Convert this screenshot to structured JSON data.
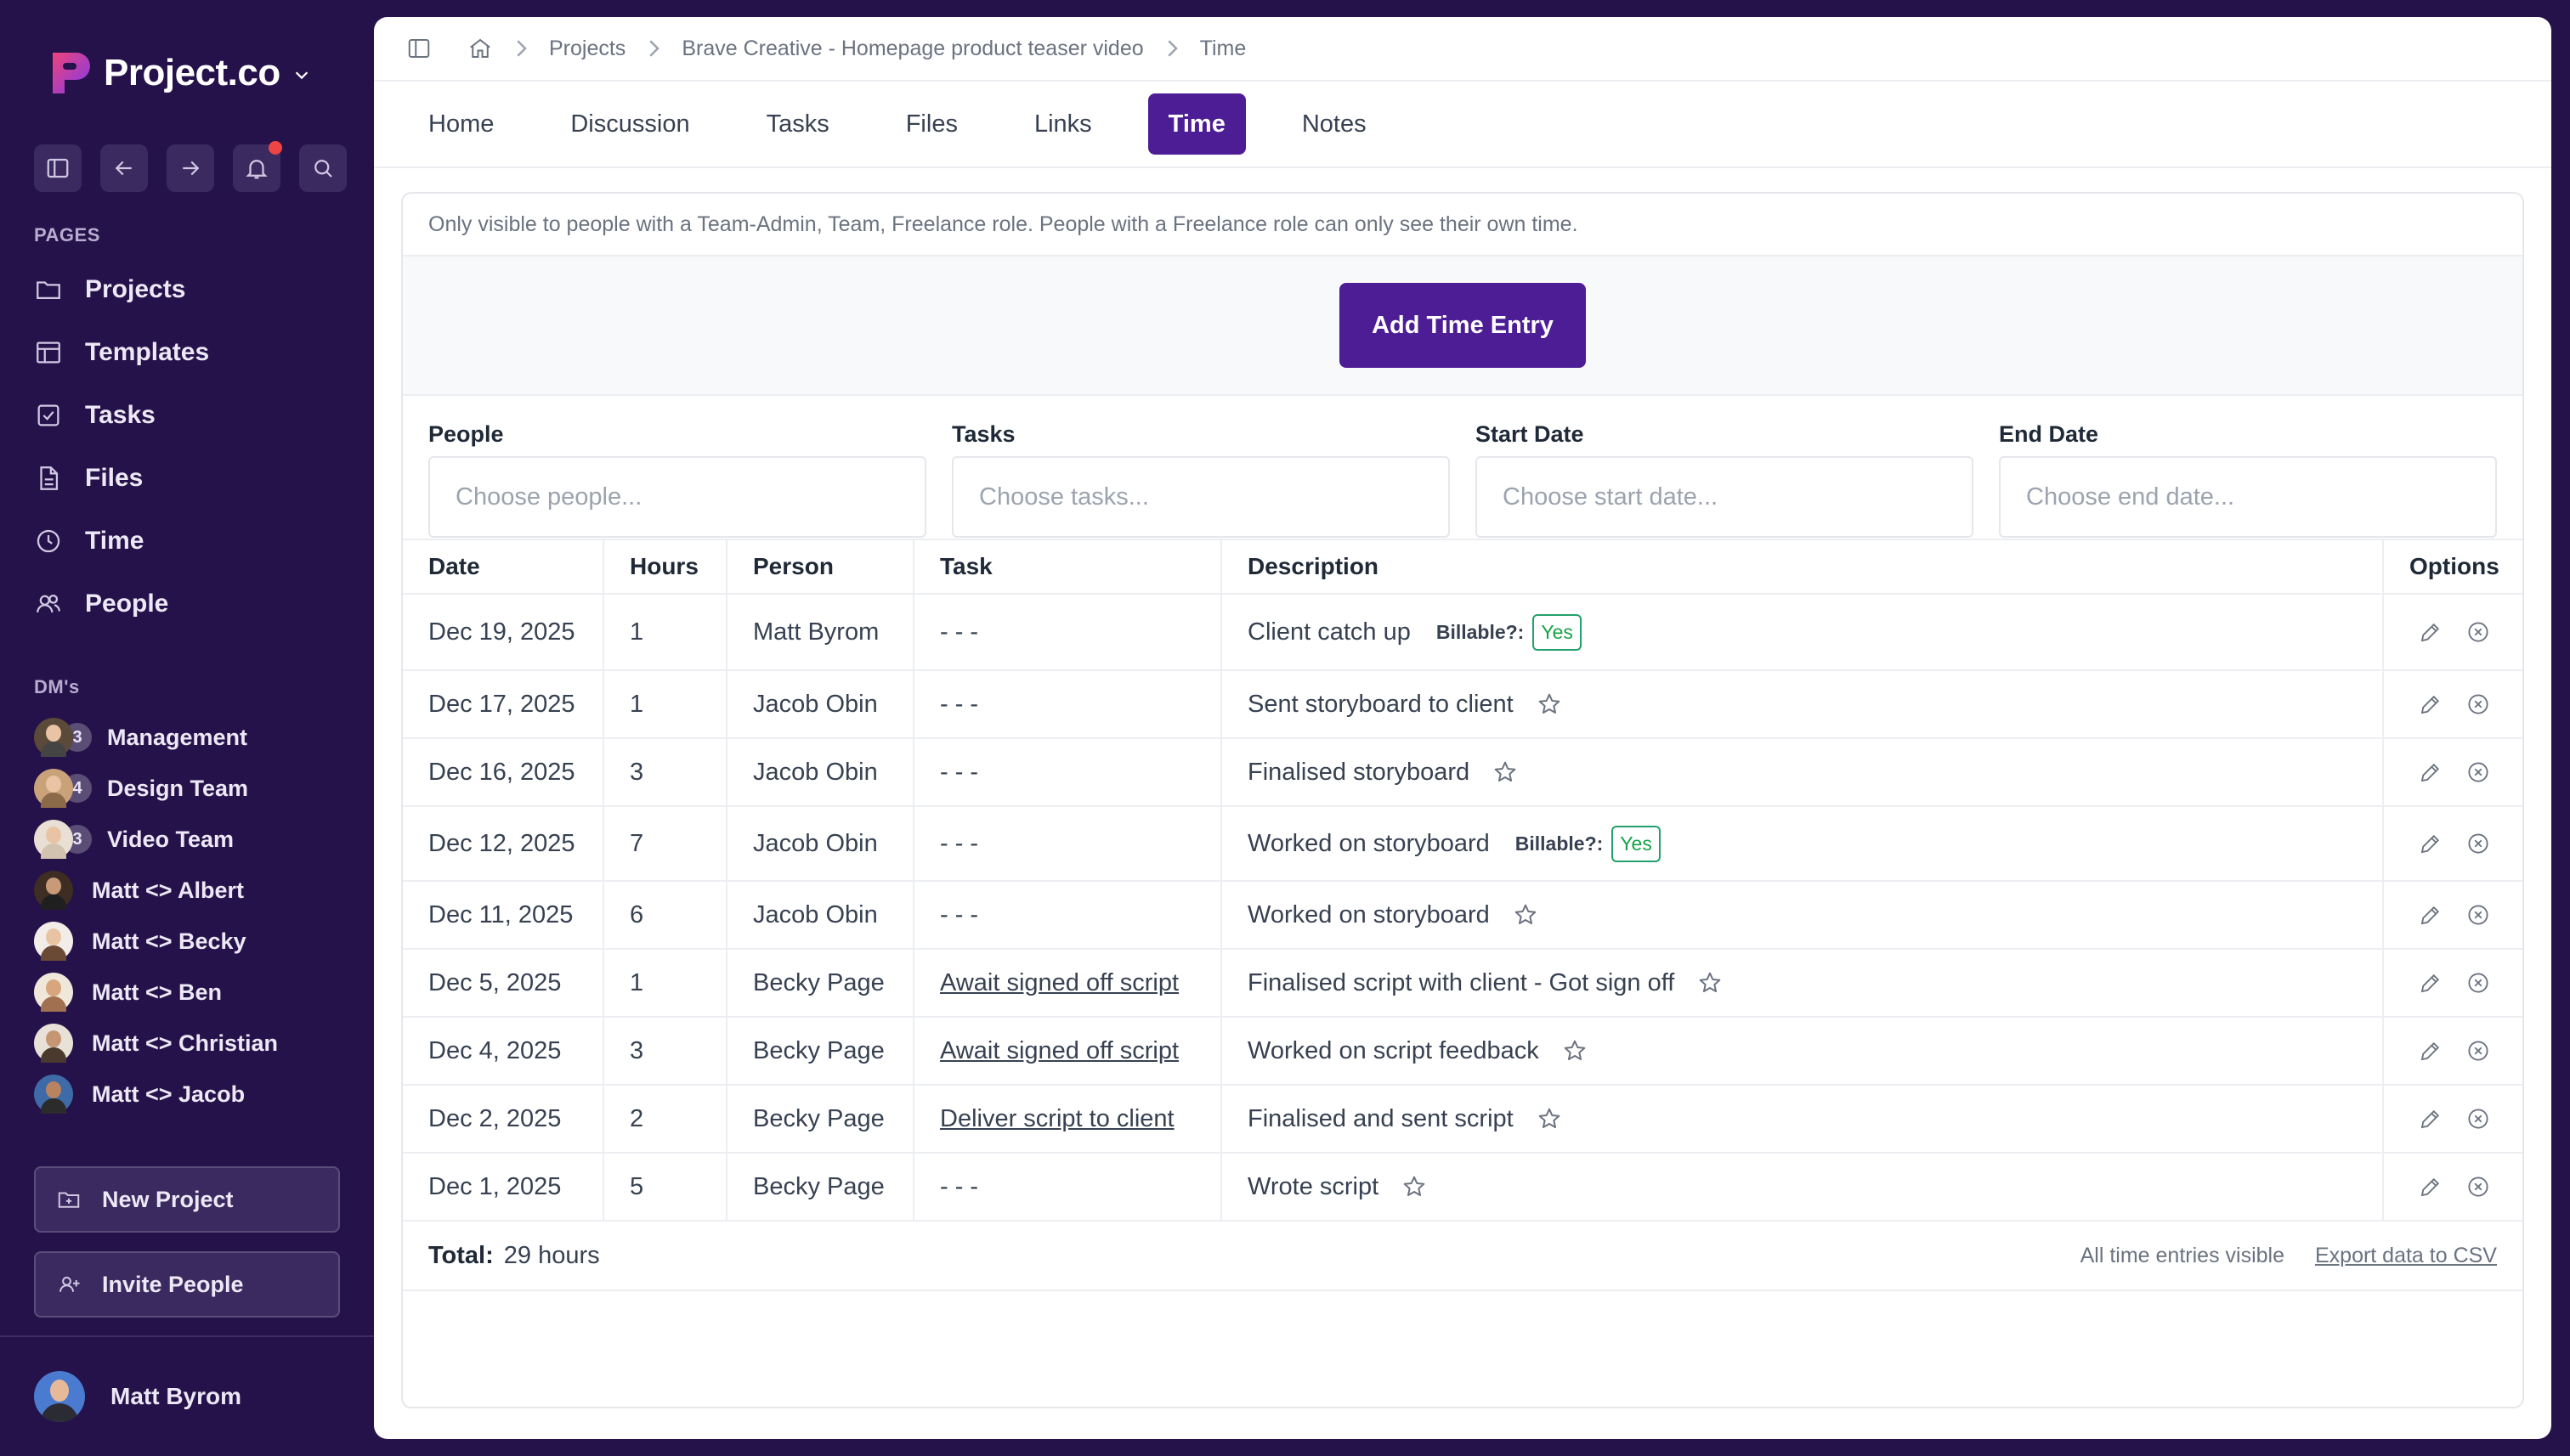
{
  "sidebar": {
    "logo": "Project.co",
    "pages_label": "PAGES",
    "nav": [
      {
        "label": "Projects",
        "icon": "folder-icon"
      },
      {
        "label": "Templates",
        "icon": "template-icon"
      },
      {
        "label": "Tasks",
        "icon": "checkbox-icon"
      },
      {
        "label": "Files",
        "icon": "file-icon"
      },
      {
        "label": "Time",
        "icon": "clock-icon"
      },
      {
        "label": "People",
        "icon": "people-icon"
      }
    ],
    "dms_label": "DM's",
    "dms": [
      {
        "label": "Management",
        "count": "3"
      },
      {
        "label": "Design Team",
        "count": "4"
      },
      {
        "label": "Video Team",
        "count": "3"
      },
      {
        "label": "Matt <> Albert"
      },
      {
        "label": "Matt <> Becky"
      },
      {
        "label": "Matt <> Ben"
      },
      {
        "label": "Matt <> Christian"
      },
      {
        "label": "Matt <> Jacob"
      }
    ],
    "new_project": "New Project",
    "invite_people": "Invite People",
    "user_name": "Matt Byrom"
  },
  "breadcrumb": {
    "items": [
      "Projects",
      "Brave Creative - Homepage product teaser video",
      "Time"
    ]
  },
  "tabs": [
    "Home",
    "Discussion",
    "Tasks",
    "Files",
    "Links",
    "Time",
    "Notes"
  ],
  "active_tab": "Time",
  "notice": "Only visible to people with a Team-Admin, Team, Freelance role. People with a Freelance role can only see their own time.",
  "add_button": "Add Time Entry",
  "filters": [
    {
      "label": "People",
      "placeholder": "Choose people..."
    },
    {
      "label": "Tasks",
      "placeholder": "Choose tasks..."
    },
    {
      "label": "Start Date",
      "placeholder": "Choose start date..."
    },
    {
      "label": "End Date",
      "placeholder": "Choose end date..."
    }
  ],
  "table": {
    "headers": [
      "Date",
      "Hours",
      "Person",
      "Task",
      "Description",
      "Options"
    ],
    "billable_label": "Billable?:",
    "yes_label": "Yes",
    "rows": [
      {
        "date": "Dec 19, 2025",
        "hours": "1",
        "person": "Matt Byrom",
        "task": "- - -",
        "task_link": false,
        "description": "Client catch up",
        "billable": true
      },
      {
        "date": "Dec 17, 2025",
        "hours": "1",
        "person": "Jacob Obin",
        "task": "- - -",
        "task_link": false,
        "description": "Sent storyboard to client",
        "billable": false
      },
      {
        "date": "Dec 16, 2025",
        "hours": "3",
        "person": "Jacob Obin",
        "task": "- - -",
        "task_link": false,
        "description": "Finalised storyboard",
        "billable": false
      },
      {
        "date": "Dec 12, 2025",
        "hours": "7",
        "person": "Jacob Obin",
        "task": "- - -",
        "task_link": false,
        "description": "Worked on storyboard",
        "billable": true
      },
      {
        "date": "Dec 11, 2025",
        "hours": "6",
        "person": "Jacob Obin",
        "task": "- - -",
        "task_link": false,
        "description": "Worked on storyboard",
        "billable": false
      },
      {
        "date": "Dec 5, 2025",
        "hours": "1",
        "person": "Becky Page",
        "task": "Await signed off script",
        "task_link": true,
        "description": "Finalised script with client - Got sign off",
        "billable": false
      },
      {
        "date": "Dec 4, 2025",
        "hours": "3",
        "person": "Becky Page",
        "task": "Await signed off script",
        "task_link": true,
        "description": "Worked on script feedback",
        "billable": false
      },
      {
        "date": "Dec 2, 2025",
        "hours": "2",
        "person": "Becky Page",
        "task": "Deliver script to client",
        "task_link": true,
        "description": "Finalised and sent script",
        "billable": false
      },
      {
        "date": "Dec 1, 2025",
        "hours": "5",
        "person": "Becky Page",
        "task": "- - -",
        "task_link": false,
        "description": "Wrote script",
        "billable": false
      }
    ]
  },
  "total": {
    "label": "Total:",
    "value": "29 hours",
    "visibility": "All time entries visible",
    "export": "Export data to CSV"
  },
  "colors": {
    "sidebar_bg": "#25124a",
    "accent": "#4c1d95",
    "billable_green": "#16a34a",
    "notification": "#ef4444"
  }
}
